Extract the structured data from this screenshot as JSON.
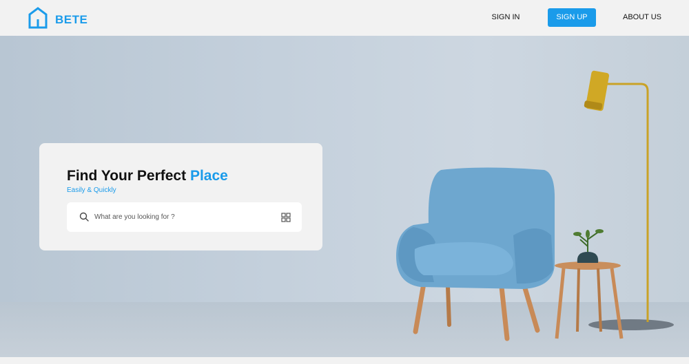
{
  "brand": {
    "name": "BETE",
    "color": "#1a9bea"
  },
  "nav": {
    "sign_in": "SIGN IN",
    "sign_up": "SIGN UP",
    "about_us": "ABOUT US"
  },
  "hero": {
    "title_main": "Find Your Perfect",
    "title_accent": "Place",
    "subtitle": "Easily & Quickly",
    "search": {
      "placeholder": "What are you looking for ?",
      "value": ""
    },
    "icons": {
      "search": "search-icon",
      "filter": "grid-icon",
      "logo": "house-icon"
    }
  }
}
